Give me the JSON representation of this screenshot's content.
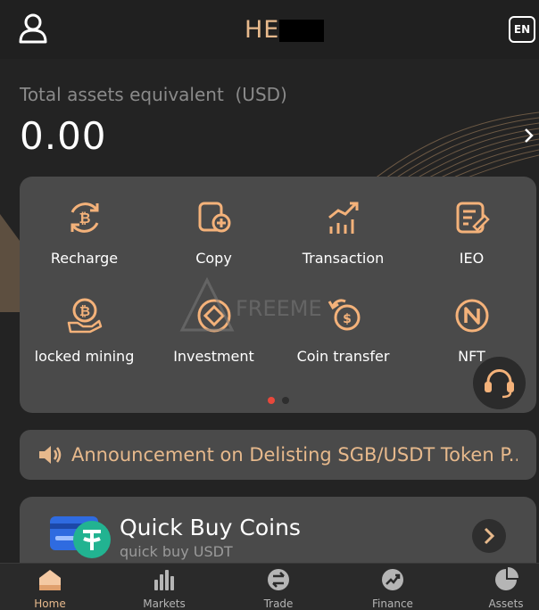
{
  "header": {
    "title": "HE",
    "lang_button": "EN",
    "icons": {
      "user": "user-icon"
    }
  },
  "assets": {
    "label": "Total assets equivalent  (USD)",
    "value": "0.00"
  },
  "grid": {
    "items": [
      {
        "label": "Recharge",
        "icon": "bitcoin-refresh-icon"
      },
      {
        "label": "Copy",
        "icon": "copy-icon"
      },
      {
        "label": "Transaction",
        "icon": "chart-up-icon"
      },
      {
        "label": "IEO",
        "icon": "document-edit-icon"
      },
      {
        "label": "locked mining",
        "icon": "bitcoin-hand-icon"
      },
      {
        "label": "Investment",
        "icon": "investment-icon"
      },
      {
        "label": "Coin transfer",
        "icon": "coin-transfer-icon"
      },
      {
        "label": "NFT",
        "icon": "nft-icon"
      }
    ],
    "watermark": "FREEME"
  },
  "announcement": {
    "text": "Announcement on Delisting SGB/USDT Token P..."
  },
  "quick_buy": {
    "title": "Quick Buy Coins",
    "subtitle": "quick buy USDT"
  },
  "nav": {
    "items": [
      {
        "label": "Home",
        "active": true
      },
      {
        "label": "Markets"
      },
      {
        "label": "Trade"
      },
      {
        "label": "Finance"
      },
      {
        "label": "Assets"
      }
    ]
  },
  "colors": {
    "accent": "#e7b98c",
    "card": "#4a4a4a",
    "background": "#232323"
  }
}
